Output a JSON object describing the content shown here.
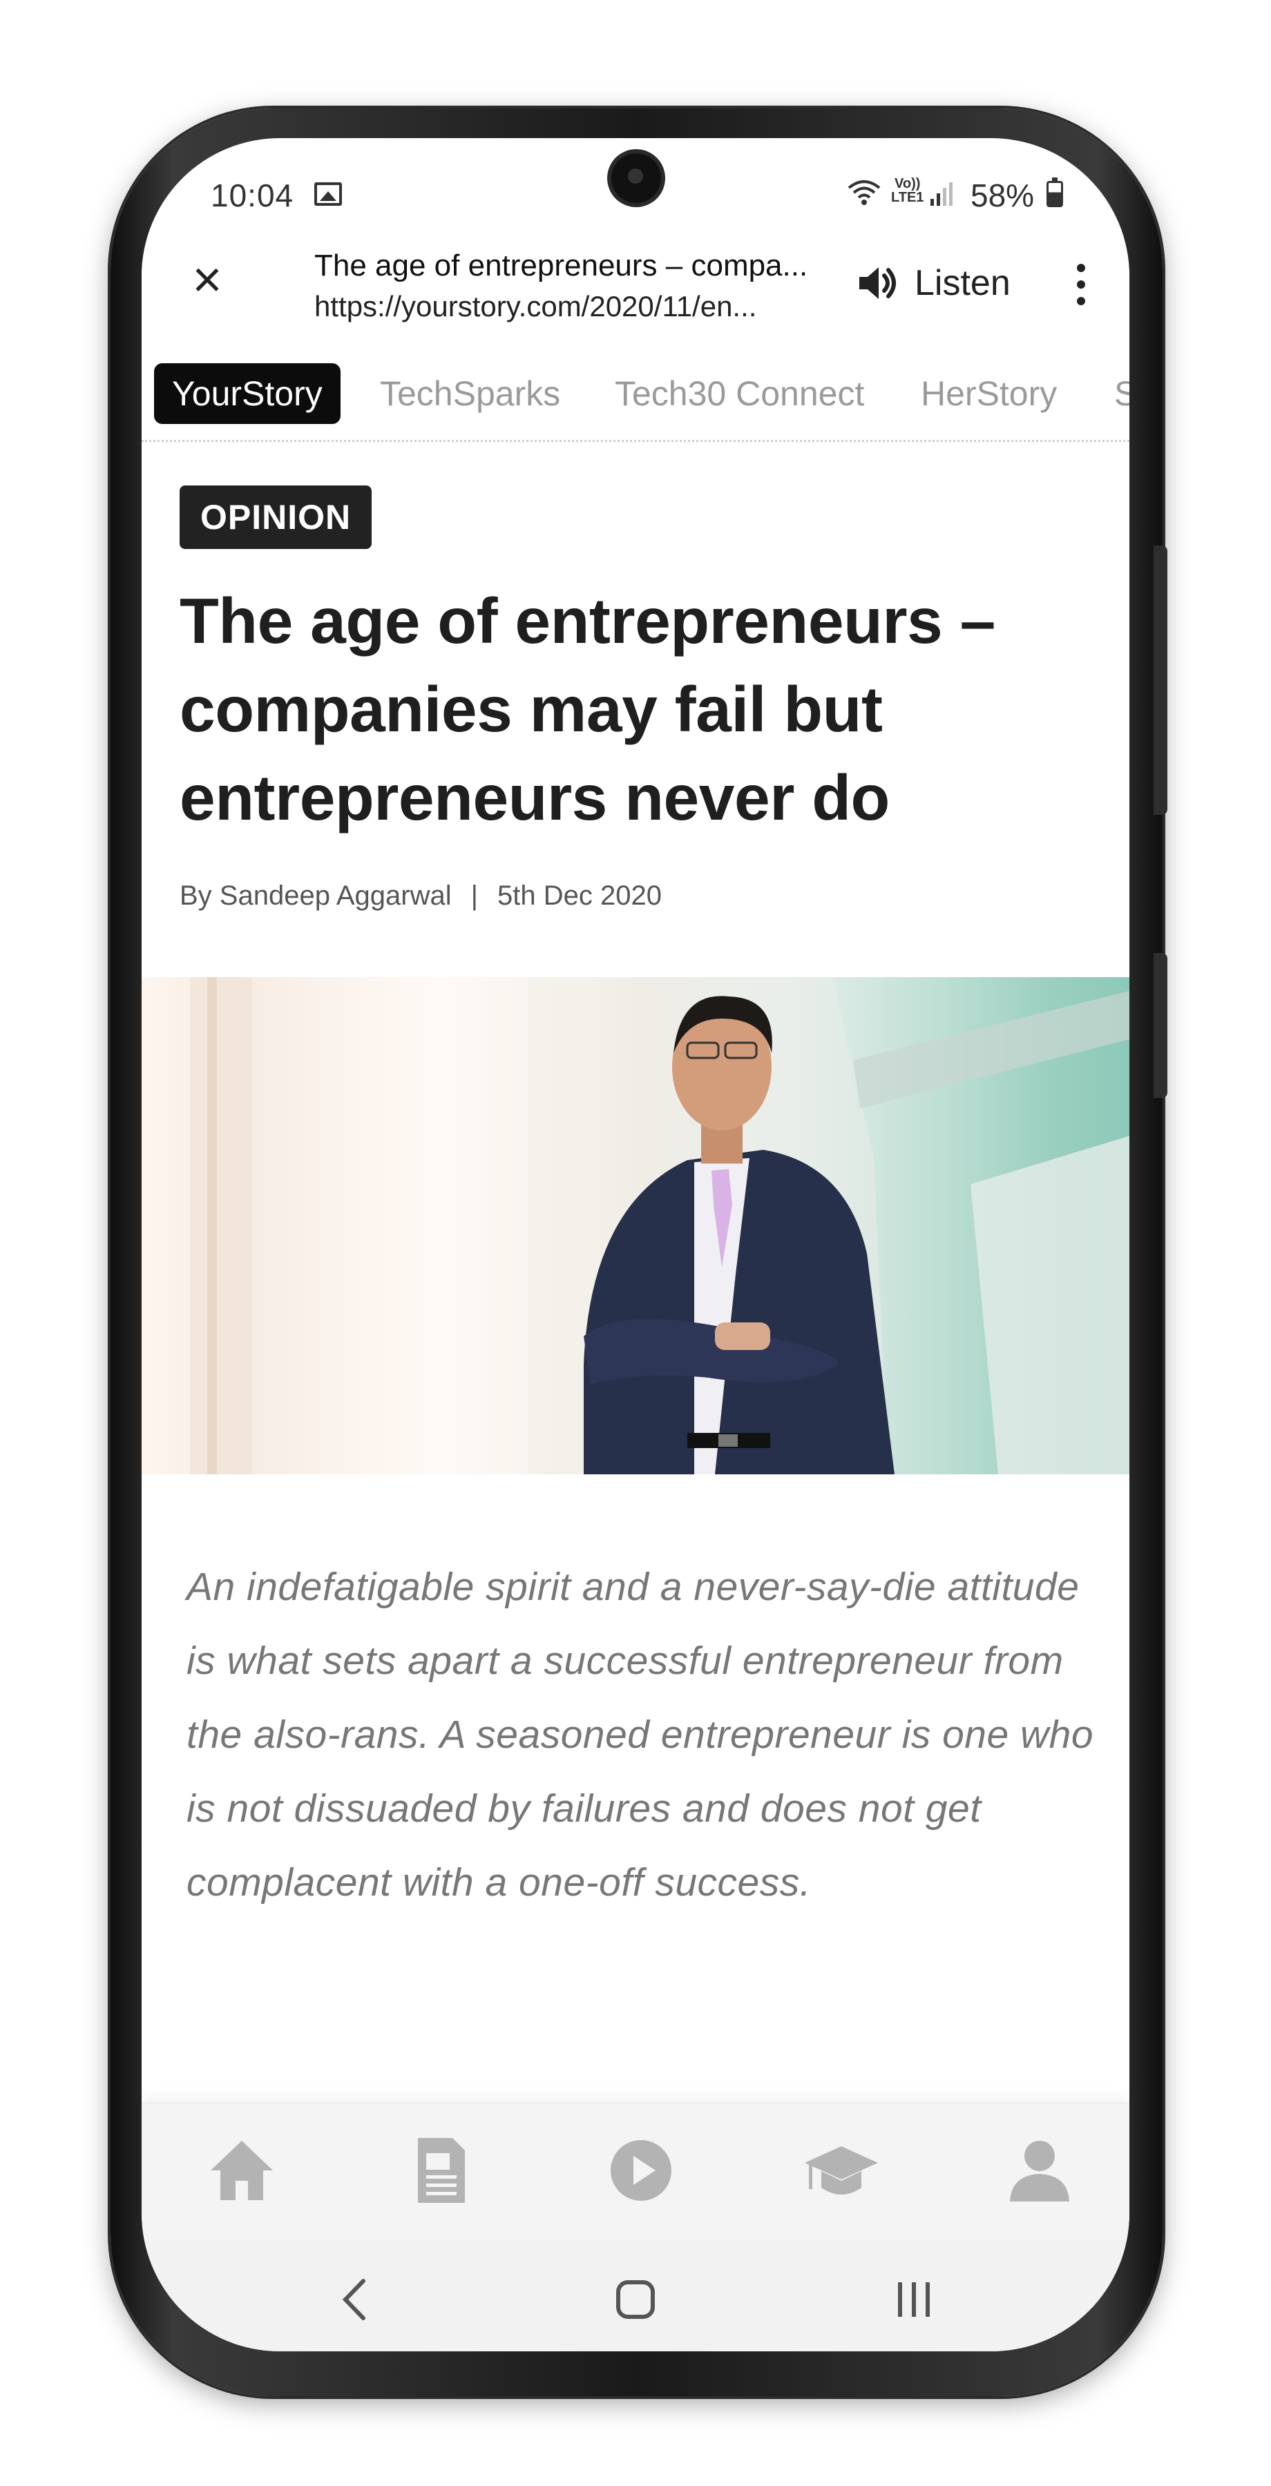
{
  "status_bar": {
    "time": "10:04",
    "volte_top": "Vo))",
    "volte_bottom": "LTE1",
    "battery": "58%"
  },
  "toolbar": {
    "title": "The age of entrepreneurs – compa...",
    "url": "https://yourstory.com/2020/11/en...",
    "listen_label": "Listen"
  },
  "tabs": [
    {
      "label": "YourStory",
      "active": true
    },
    {
      "label": "TechSparks",
      "active": false
    },
    {
      "label": "Tech30 Connect",
      "active": false
    },
    {
      "label": "HerStory",
      "active": false
    },
    {
      "label": "S",
      "active": false
    }
  ],
  "article": {
    "category": "OPINION",
    "headline": "The age of entrepreneurs – companies may fail but entrepreneurs never do",
    "author": "By Sandeep Aggarwal",
    "separator": "|",
    "date": "5th Dec 2020",
    "lede": "An indefatigable spirit and a never-say-die attitude is what sets apart a successful entrepreneur from the also-rans. A seasoned entrepreneur is one who is not dissuaded by failures and does not get complacent with a one-off success."
  },
  "bottom_nav": [
    {
      "icon": "home-icon"
    },
    {
      "icon": "document-icon"
    },
    {
      "icon": "play-icon"
    },
    {
      "icon": "graduation-cap-icon"
    },
    {
      "icon": "profile-icon"
    }
  ],
  "colors": {
    "active_tab_bg": "#0c0c0c",
    "inactive_tab_text": "#9a9a9a",
    "badge_bg": "#222222",
    "headline": "#1f1f1f",
    "lede": "#777777",
    "nav_icon": "#b3b3b3"
  }
}
